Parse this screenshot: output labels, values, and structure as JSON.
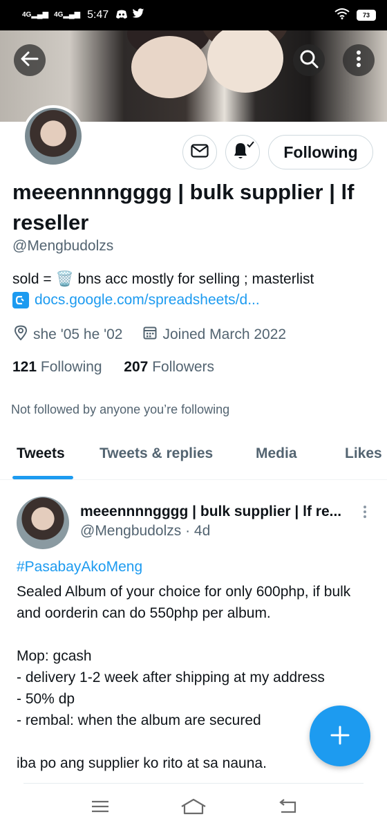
{
  "status_bar": {
    "network1": "4G",
    "network2": "4G",
    "time": "5:47",
    "battery": "73"
  },
  "profile": {
    "display_name": "meeennnngggg | bulk supplier | lf reseller",
    "handle": "@Mengbudolzs",
    "bio_text": "sold = 🗑️ bns acc mostly for selling ; masterlist",
    "bio_link": "docs.google.com/spreadsheets/d...",
    "location": "she '05 he '02",
    "joined": "Joined March 2022",
    "following_count": "121",
    "following_label": "Following",
    "followers_count": "207",
    "followers_label": "Followers",
    "not_followed": "Not followed by anyone you’re following"
  },
  "actions": {
    "following_button": "Following"
  },
  "tabs": [
    {
      "label": "Tweets"
    },
    {
      "label": "Tweets & replies"
    },
    {
      "label": "Media"
    },
    {
      "label": "Likes"
    }
  ],
  "tweet": {
    "author": "meeennnngggg | bulk supplier | lf re...",
    "handle_time": "@Mengbudolzs · 4d",
    "hashtag": "#PasabayAkoMeng",
    "body": "Sealed Album of your choice for only 600php, if bulk and oorderin can do 550php per album.\n\nMop: gcash\n- delivery 1-2 week after shipping at my address\n- 50% dp\n- rembal: when the album are secured\n\niba po ang supplier ko rito at sa nauna."
  },
  "icons": {
    "back": "arrow-left-icon",
    "search": "search-icon",
    "more": "more-vertical-icon",
    "message": "envelope-icon",
    "notify": "bell-check-icon",
    "location": "location-pin-icon",
    "calendar": "calendar-icon",
    "compose": "plus-icon"
  },
  "colors": {
    "accent": "#1d9bf0",
    "text": "#0f1419",
    "muted": "#536471"
  }
}
